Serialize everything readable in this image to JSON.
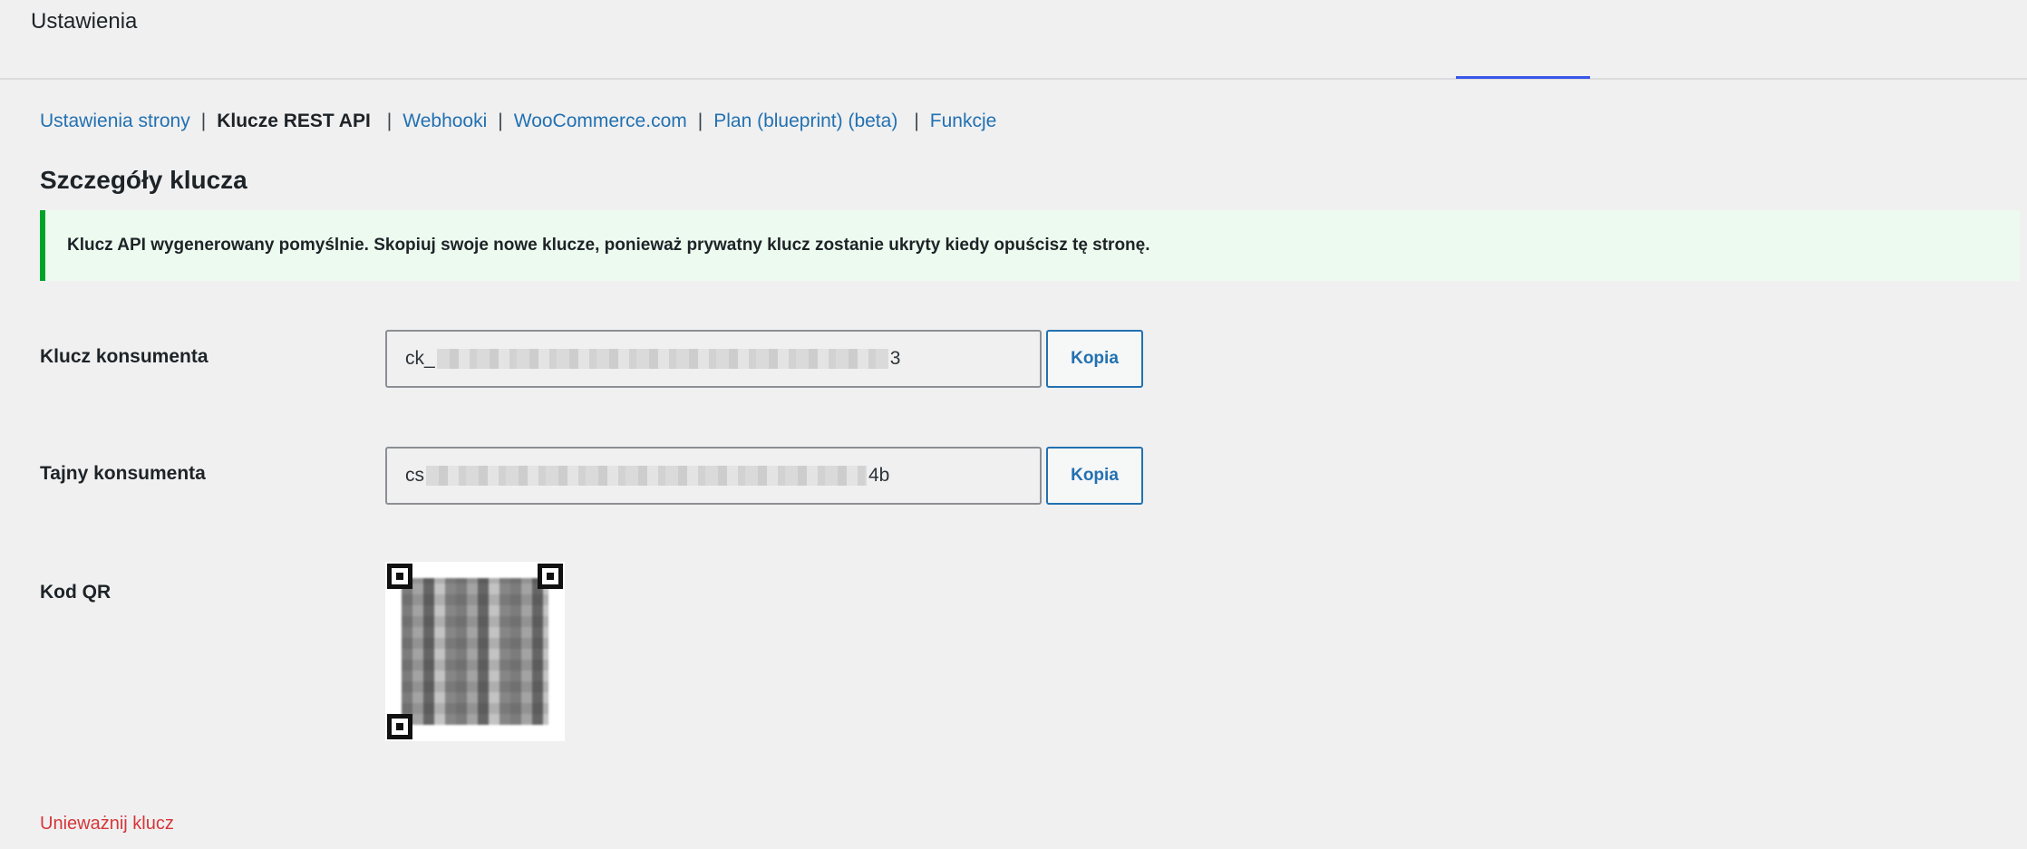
{
  "header": {
    "title": "Ustawienia"
  },
  "subnav": {
    "items": [
      {
        "label": "Ustawienia strony"
      },
      {
        "label": "Klucze REST API"
      },
      {
        "label": "Webhooki"
      },
      {
        "label": "WooCommerce.com"
      },
      {
        "label": "Plan (blueprint) (beta)"
      },
      {
        "label": "Funkcje"
      }
    ],
    "separator": "|"
  },
  "section": {
    "title": "Szczegóły klucza"
  },
  "notice": {
    "text": "Klucz API wygenerowany pomyślnie. Skopiuj swoje nowe klucze, ponieważ prywatny klucz zostanie ukryty kiedy opuścisz tę stronę."
  },
  "fields": {
    "consumer_key": {
      "label": "Klucz konsumenta",
      "prefix": "ck_",
      "suffix": "3",
      "copy_label": "Kopia"
    },
    "consumer_secret": {
      "label": "Tajny konsumenta",
      "prefix": "cs",
      "suffix": "4b",
      "copy_label": "Kopia"
    },
    "qr": {
      "label": "Kod QR"
    }
  },
  "actions": {
    "revoke_label": "Unieważnij klucz"
  },
  "colors": {
    "link": "#2271b1",
    "notice_border": "#00a32a",
    "notice_bg": "#edfaef",
    "danger": "#d63638",
    "tab_indicator": "#3858e9"
  }
}
